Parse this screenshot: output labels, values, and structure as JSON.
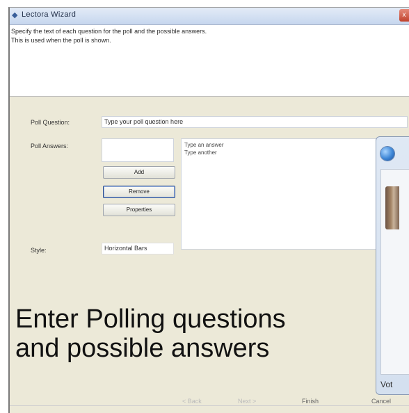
{
  "window": {
    "title": "Lectora Wizard",
    "close_label": "x"
  },
  "header": {
    "description_line1": "Specify the text of each question for the poll and the possible answers.",
    "description_line2": "This is used when the poll is shown."
  },
  "form": {
    "question_label": "Poll Question:",
    "question_value": "Type your poll question here",
    "answers_label": "Poll Answers:",
    "answers_items": [
      "Type an answer",
      "Type another"
    ],
    "add_button": "Add",
    "remove_button": "Remove",
    "preview_button": "Properties",
    "style_label": "Style:",
    "style_value": "Horizontal Bars"
  },
  "caption": {
    "line1": "Enter Polling questions",
    "line2": "and possible answers"
  },
  "footer": {
    "back_button": "< Back",
    "next_button": "Next >",
    "finish_button": "Finish",
    "cancel_button": "Cancel"
  },
  "popup": {
    "footer_text": "Vot"
  }
}
